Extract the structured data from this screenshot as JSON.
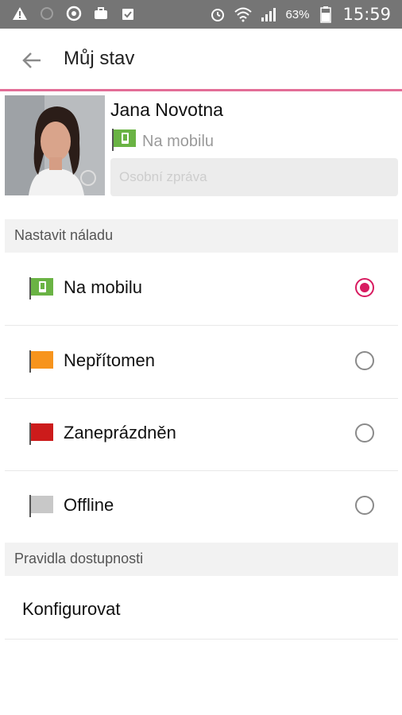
{
  "status_bar": {
    "battery_percent": "63%",
    "time": "15:59"
  },
  "app_bar": {
    "title": "Můj stav"
  },
  "profile": {
    "name": "Jana Novotna",
    "status": "Na mobilu",
    "message_placeholder": "Osobní zpráva",
    "message_value": ""
  },
  "mood_section": {
    "title": "Nastavit náladu",
    "options": [
      {
        "label": "Na mobilu",
        "flag_color": "#6ab344",
        "selected": true
      },
      {
        "label": "Nepřítomen",
        "flag_color": "#f7941d",
        "selected": false
      },
      {
        "label": "Zaneprázdněn",
        "flag_color": "#cc1b1b",
        "selected": false
      },
      {
        "label": "Offline",
        "flag_color": "#c8c8c8",
        "selected": false
      }
    ]
  },
  "availability_section": {
    "title": "Pravidla dostupnosti",
    "configure_label": "Konfigurovat"
  },
  "colors": {
    "accent": "#d81b60",
    "appbar_divider": "#e36d97",
    "statusbar": "#757575"
  }
}
